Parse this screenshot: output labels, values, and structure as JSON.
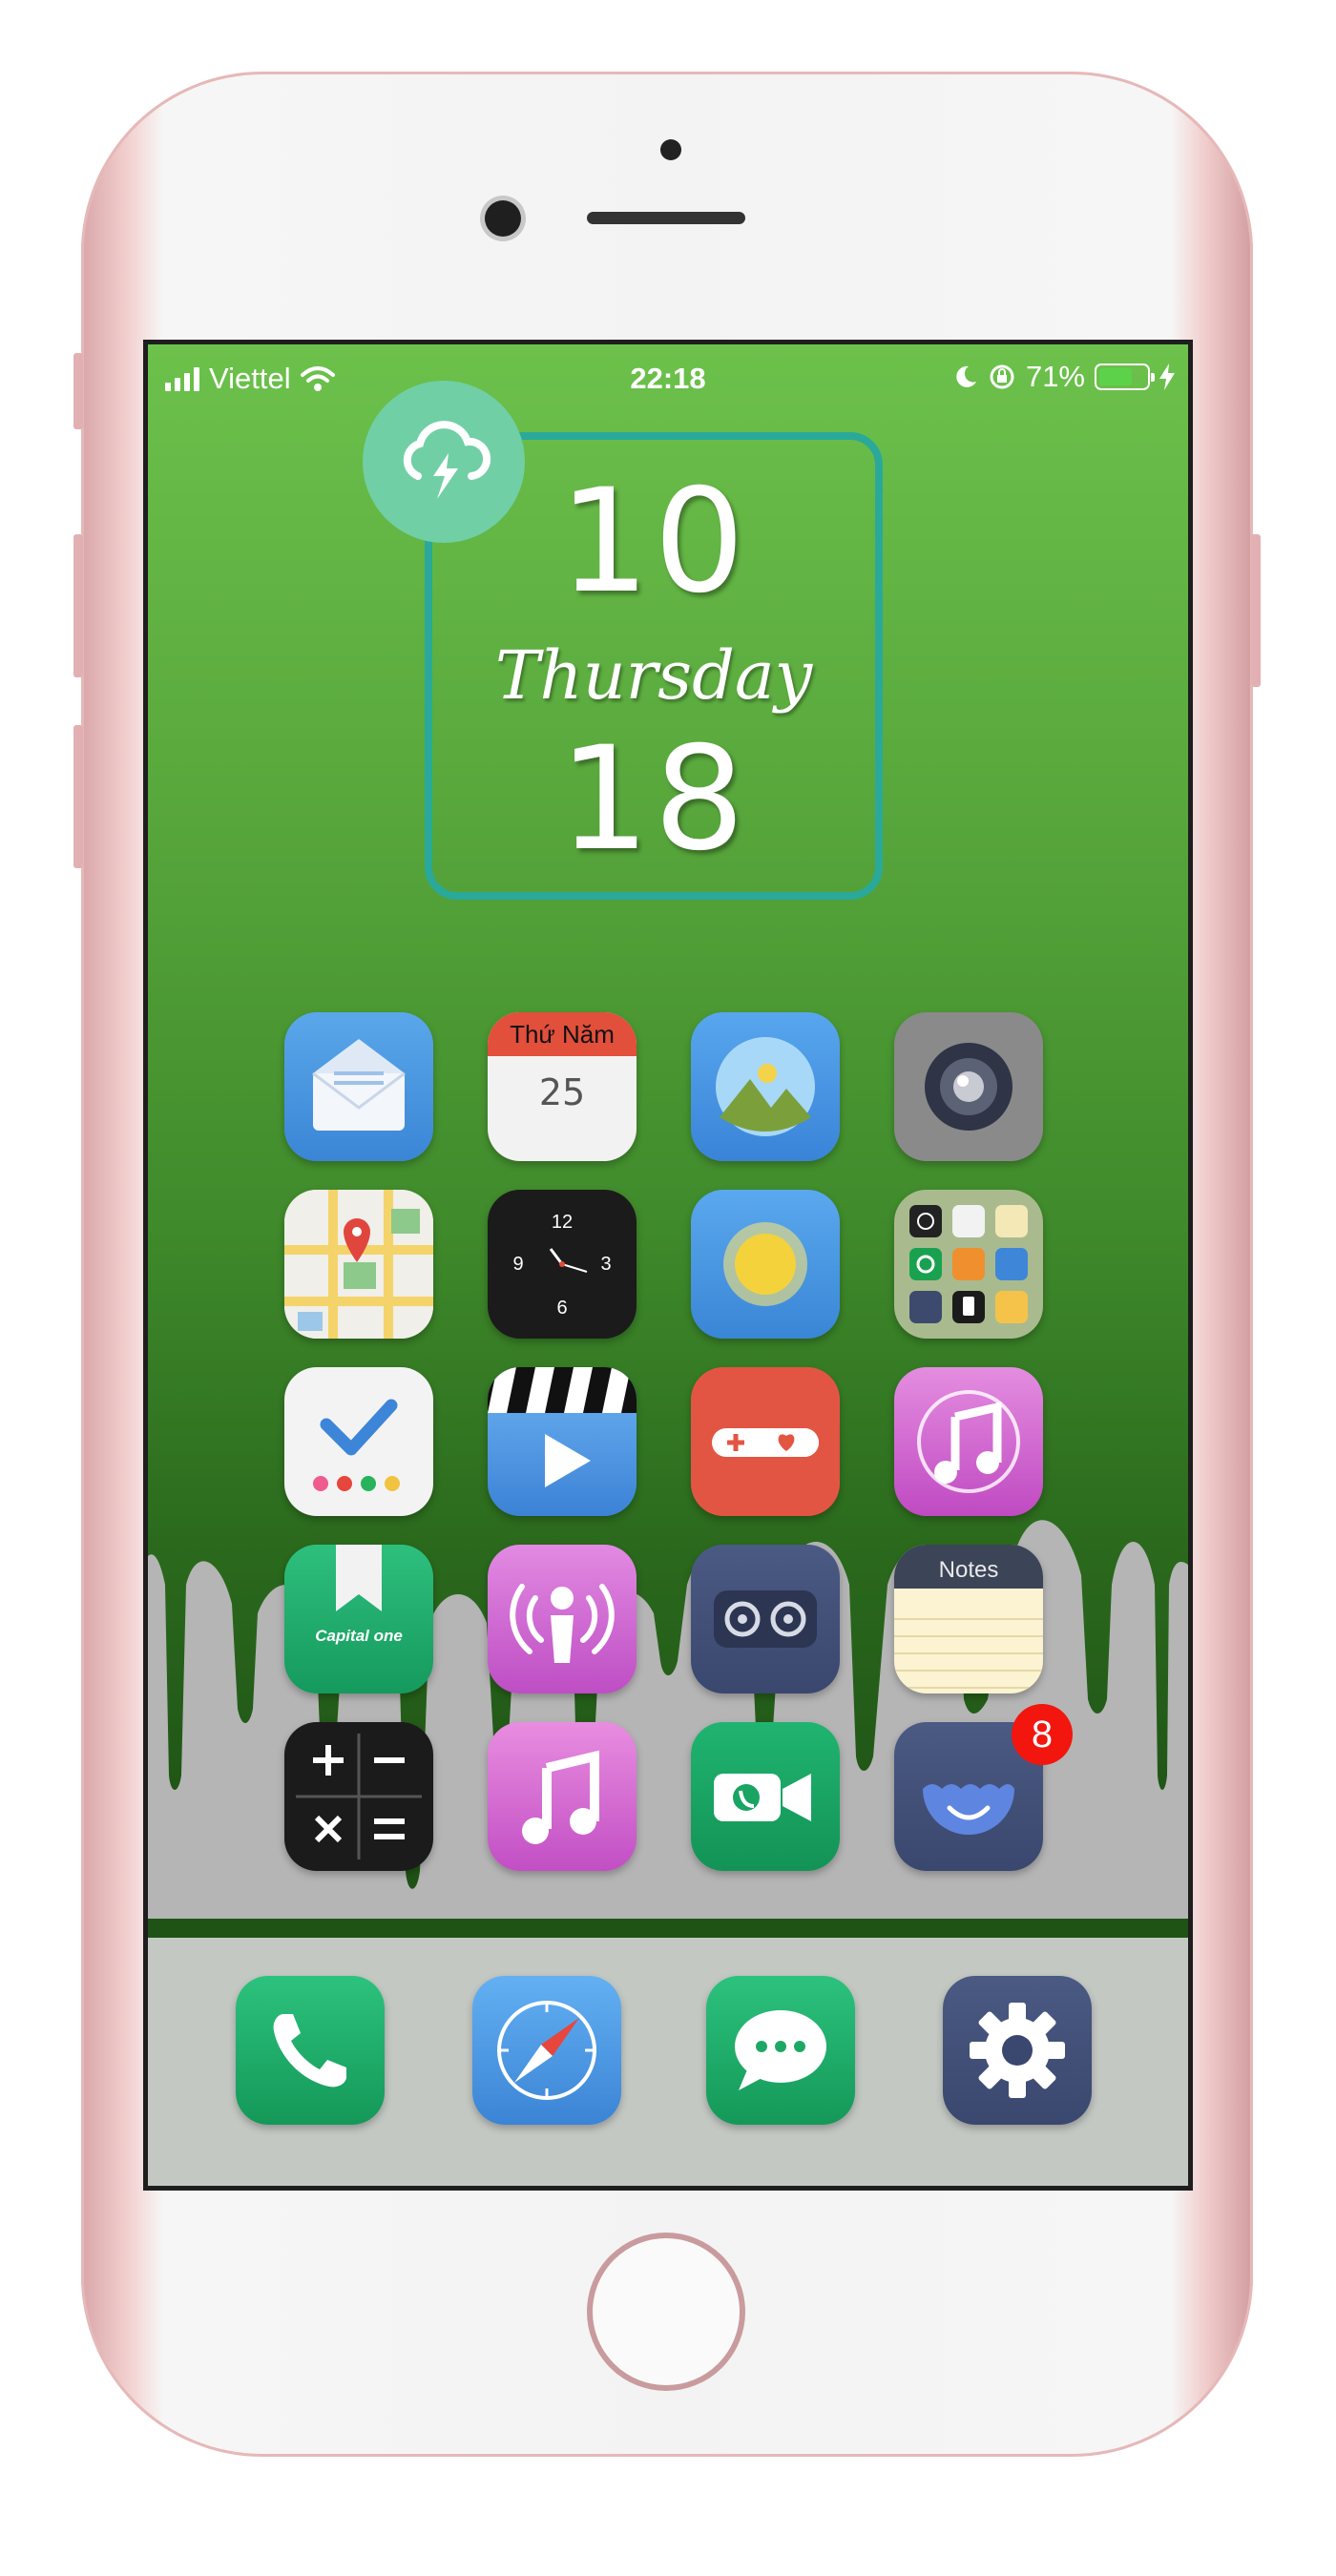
{
  "status_bar": {
    "carrier": "Viettel",
    "time": "22:18",
    "battery_percent": "71%",
    "battery_level": 0.71,
    "icons": [
      "signal-icon",
      "wifi-icon",
      "moon-icon",
      "rotation-lock-icon",
      "battery-icon",
      "charging-icon"
    ]
  },
  "widget": {
    "month": "10",
    "weekday": "Thursday",
    "day": "18",
    "weather_icon": "thunderstorm-icon",
    "frame_color": "#2aa99a"
  },
  "home_grid": {
    "calendar": {
      "header": "Thứ Năm",
      "date": "25"
    },
    "capital_one_label": "Capital one",
    "notes_header": "Notes",
    "badge_count": "8"
  },
  "colors": {
    "wallpaper_top": "#6cc14b",
    "wallpaper_bottom": "#1f5316",
    "badge": "#f2160f",
    "phone_frame": "#e2b0b2"
  }
}
